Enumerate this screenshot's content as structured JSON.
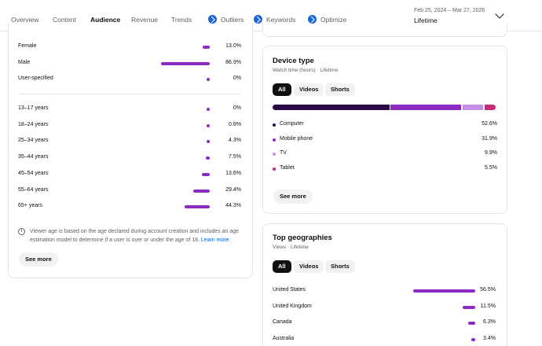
{
  "nav": {
    "tabs": [
      {
        "label": "Overview",
        "icon": null
      },
      {
        "label": "Content",
        "icon": null
      },
      {
        "label": "Audience",
        "icon": null,
        "active": true
      },
      {
        "label": "Revenue",
        "icon": null
      },
      {
        "label": "Trends",
        "icon": null
      },
      {
        "label": "Outliers",
        "icon": "bolt-icon"
      },
      {
        "label": "Keywords",
        "icon": "bolt-icon"
      },
      {
        "label": "Optimize",
        "icon": "bolt-icon"
      }
    ],
    "date_range": "Feb 25, 2024 – Mar 27, 2026",
    "period": "Lifetime"
  },
  "gender": [
    {
      "label": "Female",
      "pct": "13.0%",
      "value": 13.0
    },
    {
      "label": "Male",
      "pct": "86.9%",
      "value": 86.9
    },
    {
      "label": "User-specified",
      "pct": "0%",
      "value": 0
    }
  ],
  "age": [
    {
      "label": "13–17 years",
      "pct": "0%",
      "value": 0
    },
    {
      "label": "18–24 years",
      "pct": "0.8%",
      "value": 0.8
    },
    {
      "label": "25–34 years",
      "pct": "4.3%",
      "value": 4.3
    },
    {
      "label": "35–44 years",
      "pct": "7.5%",
      "value": 7.5
    },
    {
      "label": "45–54 years",
      "pct": "13.6%",
      "value": 13.6
    },
    {
      "label": "55–64 years",
      "pct": "29.4%",
      "value": 29.4
    },
    {
      "label": "65+ years",
      "pct": "44.3%",
      "value": 44.3
    }
  ],
  "age_note": {
    "text": "Viewer age is based on the age declared during account creation and includes an age estimation model to determine if a user is over or under the age of 18.",
    "link": "Learn more"
  },
  "left_see_more": "See more",
  "device": {
    "title": "Device type",
    "subtitle": "Watch time (hours) · Lifetime",
    "chips": [
      "All",
      "Videos",
      "Shorts"
    ],
    "items": [
      {
        "label": "Computer",
        "pct": "52.6%",
        "value": 52.6,
        "color": "#280a44"
      },
      {
        "label": "Mobile phone",
        "pct": "31.9%",
        "value": 31.9,
        "color": "#8c2bc4"
      },
      {
        "label": "TV",
        "pct": "9.9%",
        "value": 9.9,
        "color": "#c28ee6"
      },
      {
        "label": "Tablet",
        "pct": "5.5%",
        "value": 5.5,
        "color": "#c72a78"
      }
    ],
    "see_more": "See more"
  },
  "geo": {
    "title": "Top geographies",
    "subtitle": "Views · Lifetime",
    "chips": [
      "All",
      "Videos",
      "Shorts"
    ],
    "items": [
      {
        "label": "United States",
        "pct": "56.5%",
        "value": 56.5
      },
      {
        "label": "United Kingdom",
        "pct": "11.5%",
        "value": 11.5
      },
      {
        "label": "Canada",
        "pct": "6.3%",
        "value": 6.3
      },
      {
        "label": "Australia",
        "pct": "3.4%",
        "value": 3.4
      }
    ]
  }
}
